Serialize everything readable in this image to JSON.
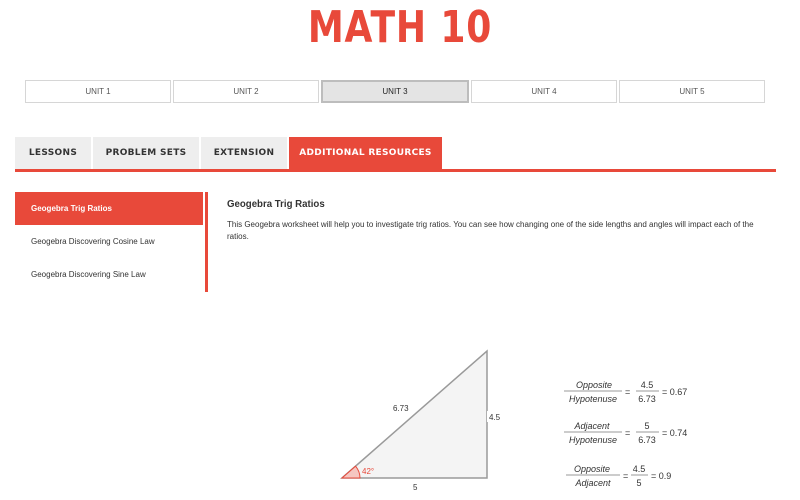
{
  "site": {
    "title": "MATH 10"
  },
  "units": [
    "UNIT 1",
    "UNIT 2",
    "UNIT 3",
    "UNIT 4",
    "UNIT 5"
  ],
  "active_unit": "UNIT 3",
  "tabs": [
    "LESSONS",
    "PROBLEM SETS",
    "EXTENSION",
    "ADDITIONAL RESOURCES"
  ],
  "active_tab": "ADDITIONAL RESOURCES",
  "sidebar": {
    "items": [
      "Geogebra Trig Ratios",
      "Geogebra Discovering Cosine Law",
      "Geogebra Discovering Sine Law"
    ]
  },
  "content": {
    "title": "Geogebra Trig Ratios",
    "description": "This Geogebra worksheet will help you to investigate trig ratios. You can see how changing one of the side lengths and angles will impact each of the ratios."
  },
  "applet": {
    "hypotenuse_label": "6.73",
    "opposite_label": "4.5",
    "adjacent_label": "5",
    "angle_label": "42°",
    "ratios": [
      {
        "num_word": "Opposite",
        "den_word": "Hypotenuse",
        "num_val": "4.5",
        "den_val": "6.73",
        "result": "= 0.67"
      },
      {
        "num_word": "Adjacent",
        "den_word": "Hypotenuse",
        "num_val": "5",
        "den_val": "6.73",
        "result": "= 0.74"
      },
      {
        "num_word": "Opposite",
        "den_word": "Adjacent",
        "num_val": "4.5",
        "den_val": "5",
        "result": "= 0.9"
      }
    ]
  },
  "colors": {
    "accent": "#e8493a",
    "tab_bg": "#eeeeee",
    "angle_mark": "#e8493a"
  }
}
